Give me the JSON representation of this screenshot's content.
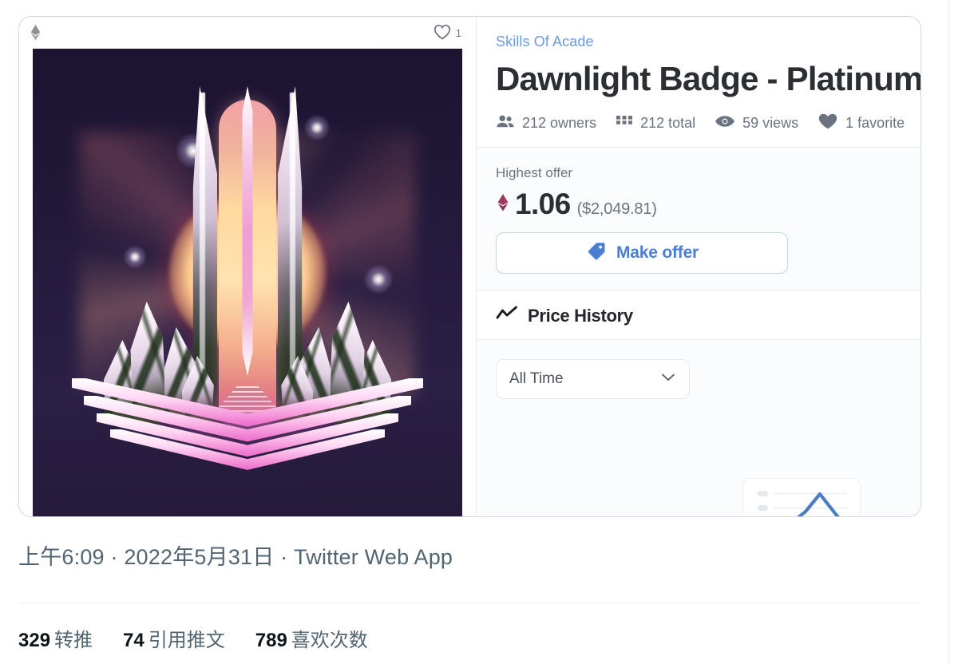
{
  "embed": {
    "asset_card": {
      "chain_icon": "ethereum-diamond-icon",
      "favorite_icon": "heart-outline-icon",
      "favorite_count": "1",
      "artwork_alt": "Dawnlight Badge Platinum neon monument artwork"
    },
    "details": {
      "collection": "Skills Of Acade",
      "title": "Dawnlight Badge - Platinum",
      "stats": [
        {
          "icon": "people-icon",
          "text": "212 owners"
        },
        {
          "icon": "grid-icon",
          "text": "212 total"
        },
        {
          "icon": "eye-icon",
          "text": "59 views"
        },
        {
          "icon": "heart-filled-icon",
          "text": "1 favorite"
        }
      ],
      "offer": {
        "label": "Highest offer",
        "currency_icon": "ethereum-diamond-icon",
        "amount": "1.06",
        "usd": "($2,049.81)",
        "button_icon": "price-tag-icon",
        "button_label": "Make offer"
      },
      "price_history": {
        "icon": "trend-line-icon",
        "title": "Price History",
        "range_selected": "All Time",
        "range_chevron_icon": "chevron-down-icon",
        "preview_icon": "line-chart-preview-icon"
      }
    }
  },
  "tweet": {
    "meta": "上午6:09 · 2022年5月31日 · Twitter Web App",
    "engagement": [
      {
        "count": "329",
        "label": "转推"
      },
      {
        "count": "74",
        "label": "引用推文"
      },
      {
        "count": "789",
        "label": "喜欢次数"
      }
    ]
  },
  "colors": {
    "link_blue": "#6d9ae0",
    "action_blue": "#4b7fd1",
    "text_dark": "#2b2e33",
    "text_muted": "#6b7280",
    "tweet_muted": "#536471",
    "eth_crimson": "#a23a5c",
    "neon_pink": "#ef6fcc",
    "card_border": "#cfd9de"
  }
}
